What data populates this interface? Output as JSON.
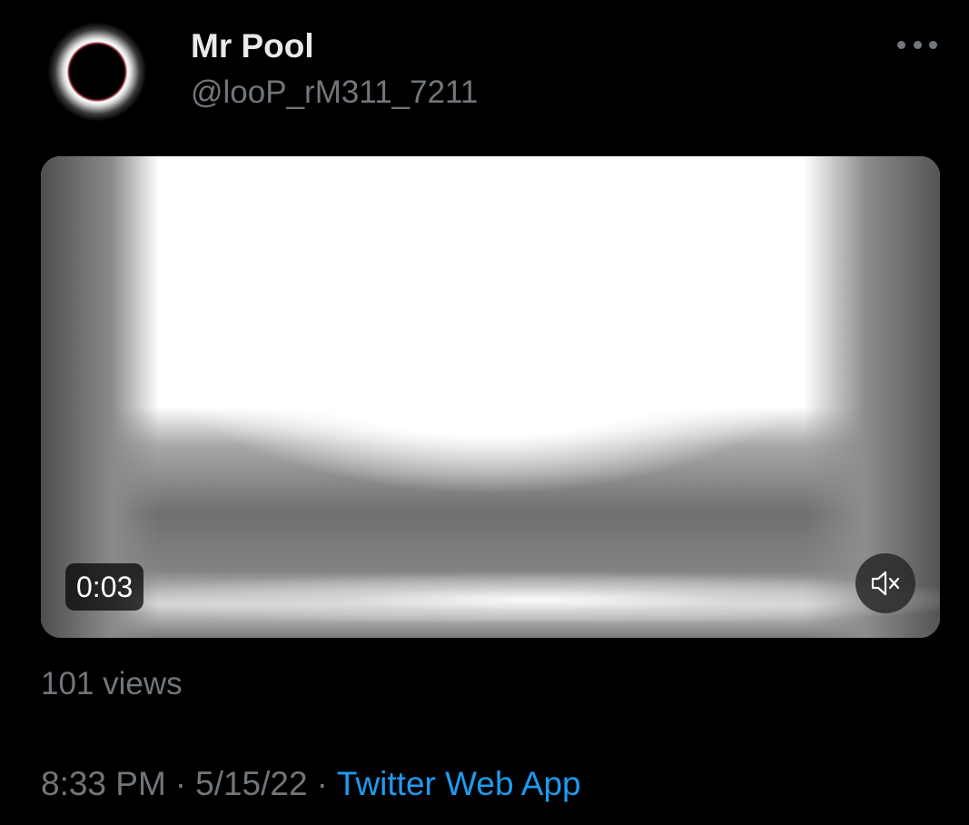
{
  "author": {
    "display_name": "Mr Pool",
    "handle": "@looP_rM311_7211",
    "avatar_icon": "solar-eclipse-avatar"
  },
  "menu": {
    "icon": "more-horizontal-icon"
  },
  "video": {
    "elapsed": "0:03",
    "mute_icon": "volume-muted-icon"
  },
  "stats": {
    "views": "101 views"
  },
  "meta": {
    "time": "8:33 PM",
    "date": "5/15/22",
    "separator": "·",
    "source": "Twitter Web App"
  },
  "colors": {
    "background": "#000000",
    "primary_text": "#e7e9ea",
    "secondary_text": "#71767b",
    "link": "#1d9bf0"
  }
}
